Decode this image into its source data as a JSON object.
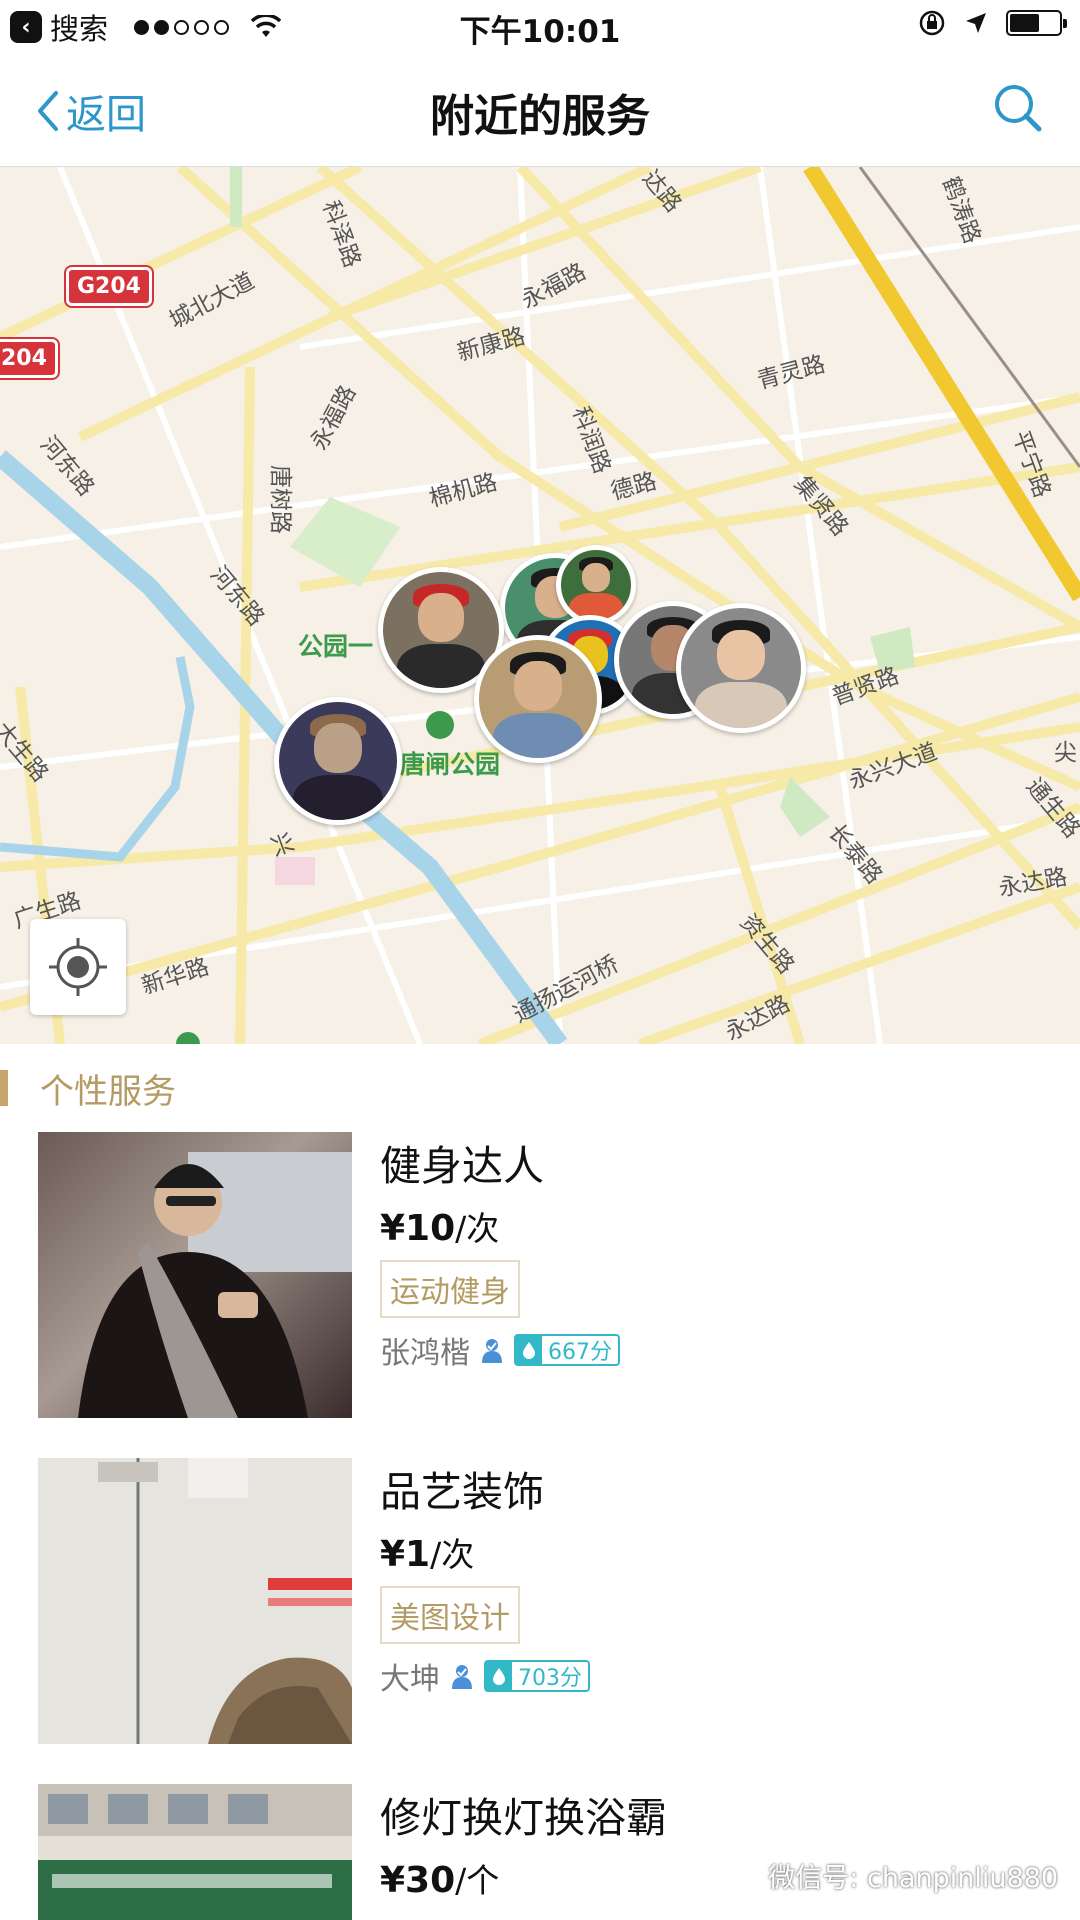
{
  "status_bar": {
    "back_app_label": "搜索",
    "time": "下午10:01",
    "signal_dots_filled": 2,
    "signal_dots_total": 5
  },
  "nav": {
    "back_label": "返回",
    "title": "附近的服务"
  },
  "map": {
    "road_badges": [
      "G204",
      "204"
    ],
    "roads": [
      "科泽路",
      "城北大道",
      "永福路",
      "新康路",
      "青灵路",
      "科润路",
      "集贤路",
      "平宁路",
      "鹤涛路",
      "永福路",
      "唐树路",
      "河东路",
      "棉机路",
      "德路",
      "河东路",
      "普贤路",
      "永兴大道",
      "通生路",
      "大生路",
      "广生路",
      "兴",
      "新华路",
      "通扬运河桥",
      "资生路",
      "长泰路",
      "永达路",
      "永达路",
      "尖",
      "达路"
    ],
    "park_labels": [
      "公园一",
      "唐闸公园"
    ]
  },
  "section": {
    "title": "个性服务"
  },
  "services": [
    {
      "title": "健身达人",
      "price": "¥10",
      "unit": "/次",
      "tag": "运动健身",
      "user": "张鸿楷",
      "score": "667分"
    },
    {
      "title": "品艺装饰",
      "price": "¥1",
      "unit": "/次",
      "tag": "美图设计",
      "user": "大坤",
      "score": "703分"
    },
    {
      "title": "修灯换灯换浴霸",
      "price": "¥30",
      "unit": "/个",
      "tag": "",
      "user": "",
      "score": ""
    }
  ],
  "watermark": "微信号: chanpinliu880",
  "colors": {
    "accent": "#2e97c9",
    "gold": "#b49a63",
    "score": "#33b8c8",
    "highway": "#f2c830",
    "canal": "#a8d4ea"
  }
}
